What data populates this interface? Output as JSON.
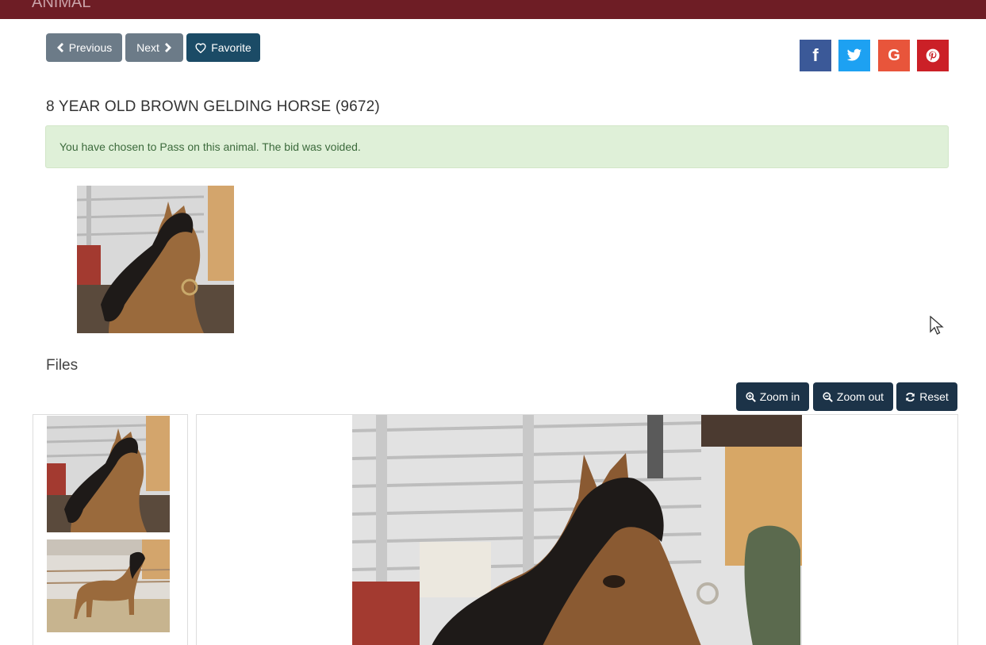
{
  "header": {
    "ghost_title": "ANIMAL"
  },
  "nav": {
    "previous_label": "Previous",
    "next_label": "Next",
    "favorite_label": "Favorite"
  },
  "social": {
    "facebook": "f",
    "google": "G",
    "colors": {
      "facebook": "#3b5998",
      "twitter": "#1da1f2",
      "google": "#e8553b",
      "pinterest": "#cb2027"
    }
  },
  "animal": {
    "title": "8 YEAR OLD BROWN GELDING HORSE (9672)",
    "status_message": "You have chosen to Pass on this animal. The bid was voided."
  },
  "files": {
    "heading": "Files",
    "zoom_in_label": "Zoom in",
    "zoom_out_label": "Zoom out",
    "reset_label": "Reset"
  },
  "icons": [
    "chevron-left-icon",
    "chevron-right-icon",
    "heart-icon",
    "facebook-icon",
    "twitter-icon",
    "google-icon",
    "pinterest-icon",
    "zoom-in-icon",
    "zoom-out-icon",
    "refresh-icon",
    "mouse-cursor-icon"
  ]
}
